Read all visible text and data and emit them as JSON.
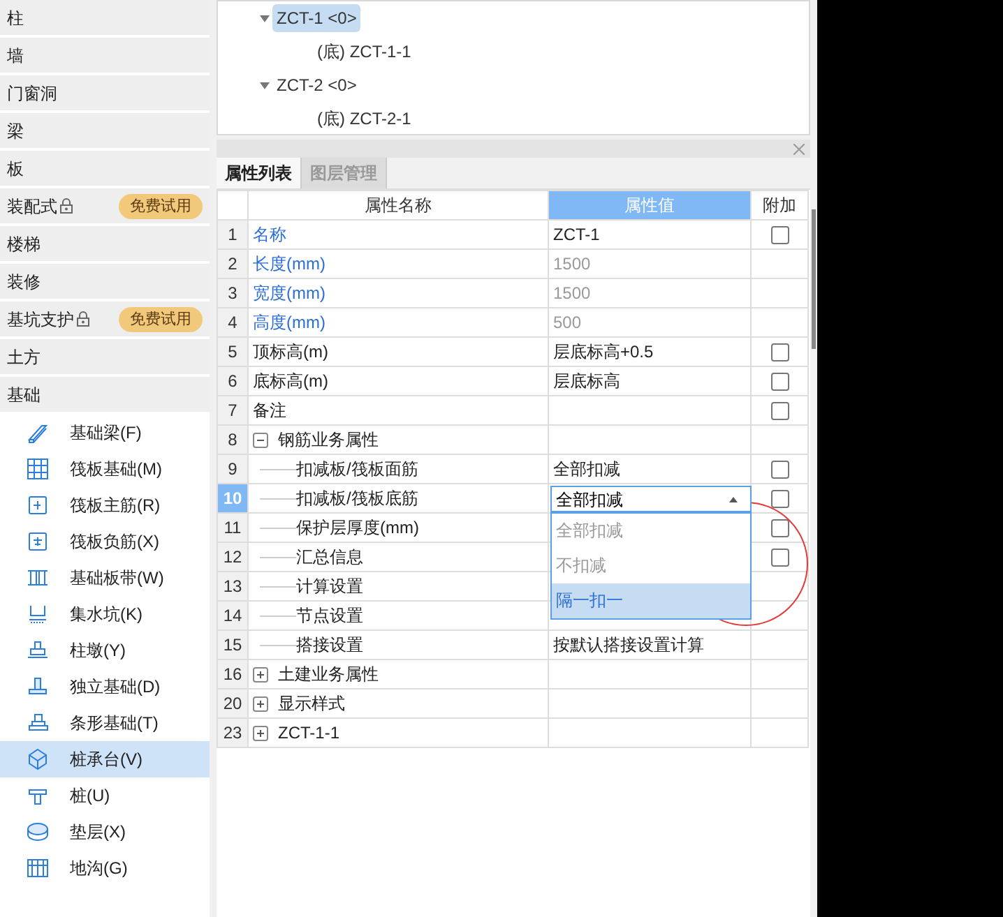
{
  "sidebar": {
    "categories": [
      {
        "label": "柱",
        "locked": false
      },
      {
        "label": "墙",
        "locked": false
      },
      {
        "label": "门窗洞",
        "locked": false
      },
      {
        "label": "梁",
        "locked": false
      },
      {
        "label": "板",
        "locked": false
      },
      {
        "label": "装配式",
        "locked": true,
        "badge": "免费试用"
      },
      {
        "label": "楼梯",
        "locked": false
      },
      {
        "label": "装修",
        "locked": false
      },
      {
        "label": "基坑支护",
        "locked": true,
        "badge": "免费试用"
      },
      {
        "label": "土方",
        "locked": false
      },
      {
        "label": "基础",
        "locked": false
      }
    ],
    "items": [
      {
        "label": "基础梁(F)",
        "selected": false
      },
      {
        "label": "筏板基础(M)",
        "selected": false
      },
      {
        "label": "筏板主筋(R)",
        "selected": false
      },
      {
        "label": "筏板负筋(X)",
        "selected": false
      },
      {
        "label": "基础板带(W)",
        "selected": false
      },
      {
        "label": "集水坑(K)",
        "selected": false
      },
      {
        "label": "柱墩(Y)",
        "selected": false
      },
      {
        "label": "独立基础(D)",
        "selected": false
      },
      {
        "label": "条形基础(T)",
        "selected": false
      },
      {
        "label": "桩承台(V)",
        "selected": true
      },
      {
        "label": "桩(U)",
        "selected": false
      },
      {
        "label": "垫层(X)",
        "selected": false
      },
      {
        "label": "地沟(G)",
        "selected": false
      }
    ]
  },
  "tree": [
    {
      "label": "ZCT-1 <0>",
      "selected": true,
      "expanded": true,
      "children": [
        {
          "label": "(底) ZCT-1-1",
          "selected": false
        }
      ]
    },
    {
      "label": "ZCT-2 <0>",
      "selected": false,
      "expanded": true,
      "children": [
        {
          "label": "(底) ZCT-2-1",
          "selected": false
        }
      ]
    }
  ],
  "tabs": [
    {
      "label": "属性列表",
      "selected": true
    },
    {
      "label": "图层管理",
      "selected": false
    }
  ],
  "table": {
    "columns": [
      "属性名称",
      "属性值",
      "附加"
    ],
    "rows": [
      {
        "num": "1",
        "name": "名称",
        "kind": "public",
        "value": "ZCT-1",
        "disabled": false,
        "checked": false,
        "selected": false
      },
      {
        "num": "2",
        "name": "长度(mm)",
        "kind": "public",
        "value": "1500",
        "disabled": true,
        "selected": false
      },
      {
        "num": "3",
        "name": "宽度(mm)",
        "kind": "public",
        "value": "1500",
        "disabled": true,
        "selected": false
      },
      {
        "num": "4",
        "name": "高度(mm)",
        "kind": "public",
        "value": "500",
        "disabled": true,
        "selected": false
      },
      {
        "num": "5",
        "name": "顶标高(m)",
        "kind": "plain",
        "value": "层底标高+0.5",
        "disabled": false,
        "checked": false,
        "selected": false
      },
      {
        "num": "6",
        "name": "底标高(m)",
        "kind": "plain",
        "value": "层底标高",
        "disabled": false,
        "checked": false,
        "selected": false
      },
      {
        "num": "7",
        "name": "备注",
        "kind": "plain",
        "checked": false,
        "selected": false
      },
      {
        "num": "8",
        "name": "钢筋业务属性",
        "kind": "group",
        "expanded": true,
        "selected": false
      },
      {
        "num": "9",
        "name": "扣减板/筏板面筋",
        "kind": "child",
        "value": "全部扣减",
        "disabled": false,
        "checked": false,
        "selected": false
      },
      {
        "num": "10",
        "name": "扣减板/筏板底筋",
        "kind": "child",
        "checked": false,
        "selected": true,
        "dropdown": {
          "value": "全部扣减",
          "options": [
            {
              "label": "全部扣减",
              "highlighted": false
            },
            {
              "label": "不扣减",
              "highlighted": false
            },
            {
              "label": "隔一扣一",
              "highlighted": true
            }
          ]
        }
      },
      {
        "num": "11",
        "name": "保护层厚度(mm)",
        "kind": "child",
        "checked": false,
        "selected": false
      },
      {
        "num": "12",
        "name": "汇总信息",
        "kind": "child",
        "checked": false,
        "selected": false
      },
      {
        "num": "13",
        "name": "计算设置",
        "kind": "child",
        "selected": false
      },
      {
        "num": "14",
        "name": "节点设置",
        "kind": "child",
        "selected": false
      },
      {
        "num": "15",
        "name": "搭接设置",
        "kind": "child",
        "value": "按默认搭接设置计算",
        "disabled": false,
        "selected": false
      },
      {
        "num": "16",
        "name": "土建业务属性",
        "kind": "group",
        "expanded": false,
        "selected": false
      },
      {
        "num": "20",
        "name": "显示样式",
        "kind": "group",
        "expanded": false,
        "selected": false
      },
      {
        "num": "23",
        "name": "ZCT-1-1",
        "kind": "group",
        "expanded": false,
        "selected": false
      }
    ]
  }
}
